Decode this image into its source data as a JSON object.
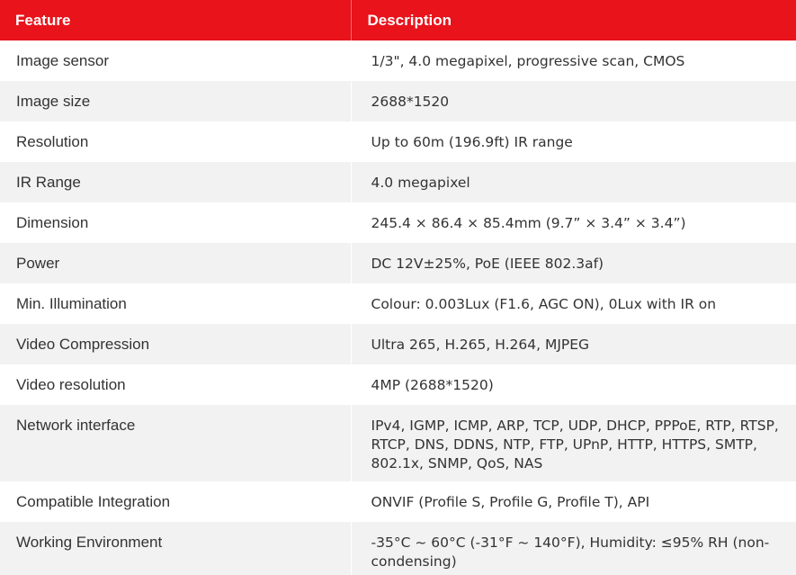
{
  "header": {
    "feature": "Feature",
    "description": "Description"
  },
  "rows": [
    {
      "feature": "Image sensor",
      "description": "1/3\", 4.0 megapixel, progressive scan, CMOS"
    },
    {
      "feature": "Image size",
      "description": "2688*1520"
    },
    {
      "feature": "Resolution",
      "description": "Up to 60m (196.9ft) IR range"
    },
    {
      "feature": "IR Range",
      "description": "4.0 megapixel"
    },
    {
      "feature": "Dimension",
      "description": "245.4 × 86.4 × 85.4mm (9.7” × 3.4” × 3.4”)"
    },
    {
      "feature": "Power",
      "description": "DC 12V±25%, PoE (IEEE 802.3af)"
    },
    {
      "feature": "Min. Illumination",
      "description": "Colour: 0.003Lux (F1.6, AGC ON), 0Lux with IR on"
    },
    {
      "feature": "Video Compression",
      "description": "Ultra 265, H.265, H.264, MJPEG"
    },
    {
      "feature": "Video resolution",
      "description": "4MP (2688*1520)"
    },
    {
      "feature": "Network interface",
      "description": "IPv4, IGMP, ICMP, ARP, TCP, UDP, DHCP, PPPoE, RTP, RTSP, RTCP, DNS, DDNS, NTP, FTP, UPnP, HTTP, HTTPS, SMTP, 802.1x, SNMP, QoS, NAS"
    },
    {
      "feature": "Compatible Integration",
      "description": "ONVIF (Profile S, Profile G, Profile T), API"
    },
    {
      "feature": "Working Environment",
      "description": "-35°C ~ 60°C (-31°F ~ 140°F), Humidity: ≤95% RH (non-condensing)"
    }
  ],
  "colors": {
    "header_background": "#e8131b",
    "header_text": "#ffffff",
    "stripe_background": "#f2f2f2",
    "body_text": "#333333"
  }
}
